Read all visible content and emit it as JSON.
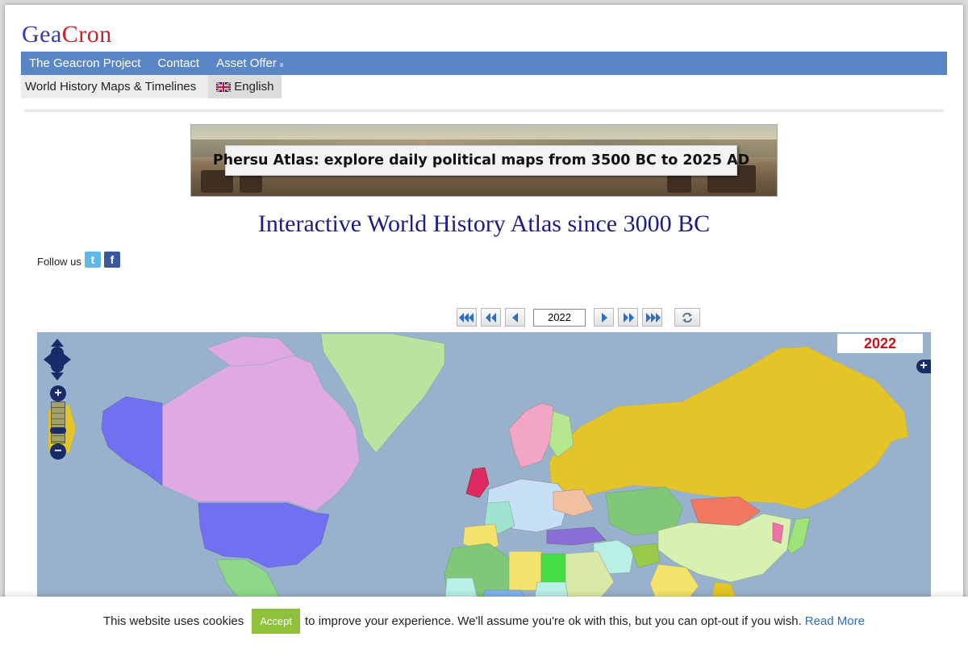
{
  "logo": {
    "part1": "Gea",
    "part2": "Cron"
  },
  "nav": {
    "items": [
      "The Geacron Project",
      "Contact",
      "Asset Offer"
    ],
    "dropdown_glyph": "»"
  },
  "subnav": {
    "tab": "World History Maps & Timelines",
    "language": "English"
  },
  "banner": {
    "text": "Phersu Atlas: explore daily political maps from 3500 BC to 2025 AD"
  },
  "page_title": "Interactive World History Atlas since 3000 BC",
  "follow": {
    "label": "Follow us",
    "twitter_icon": "t",
    "facebook_icon": "f"
  },
  "timeline": {
    "year_value": "2022"
  },
  "map": {
    "year_label": "2022"
  },
  "cookie": {
    "text_before": "This website uses cookies",
    "accept_label": "Accept",
    "text_after": "to improve your experience. We'll assume you're ok with this, but you can opt-out if you wish.",
    "read_more": "Read More"
  },
  "colors": {
    "nav_bg": "#5b86c6",
    "title": "#1b1d85",
    "ocean": "#98b1cc",
    "year_label": "#d0101a",
    "accept_bg": "#8fc13a",
    "control_dark": "#1a2b6a"
  }
}
